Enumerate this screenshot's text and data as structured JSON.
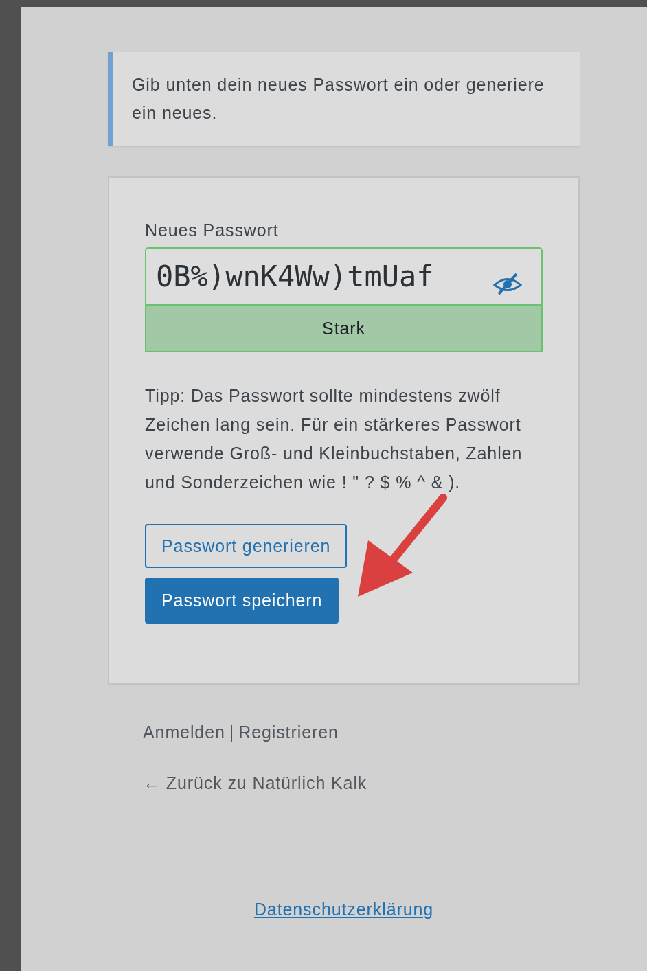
{
  "notice": {
    "text": "Gib unten dein neues Passwort ein oder generiere ein neues."
  },
  "form": {
    "label": "Neues Passwort",
    "password": "0B%)wnK4Ww)tmUaf",
    "strength": "Stark",
    "hint": "Tipp: Das Passwort sollte mindestens zwölf Zeichen lang sein. Für ein stärkeres Passwort verwende Groß- und Kleinbuchstaben, Zahlen und Sonderzeichen wie ! \" ? $ % ^ & ).",
    "buttons": [
      {
        "label": "Passwort generieren",
        "kind": "secondary"
      },
      {
        "label": "Passwort speichern",
        "kind": "primary"
      }
    ]
  },
  "nav": {
    "login": "Anmelden",
    "separator": "|",
    "register": "Registrieren"
  },
  "back_link": "← Zurück zu Natürlich Kalk",
  "privacy_link": "Datenschutzerklärung"
}
